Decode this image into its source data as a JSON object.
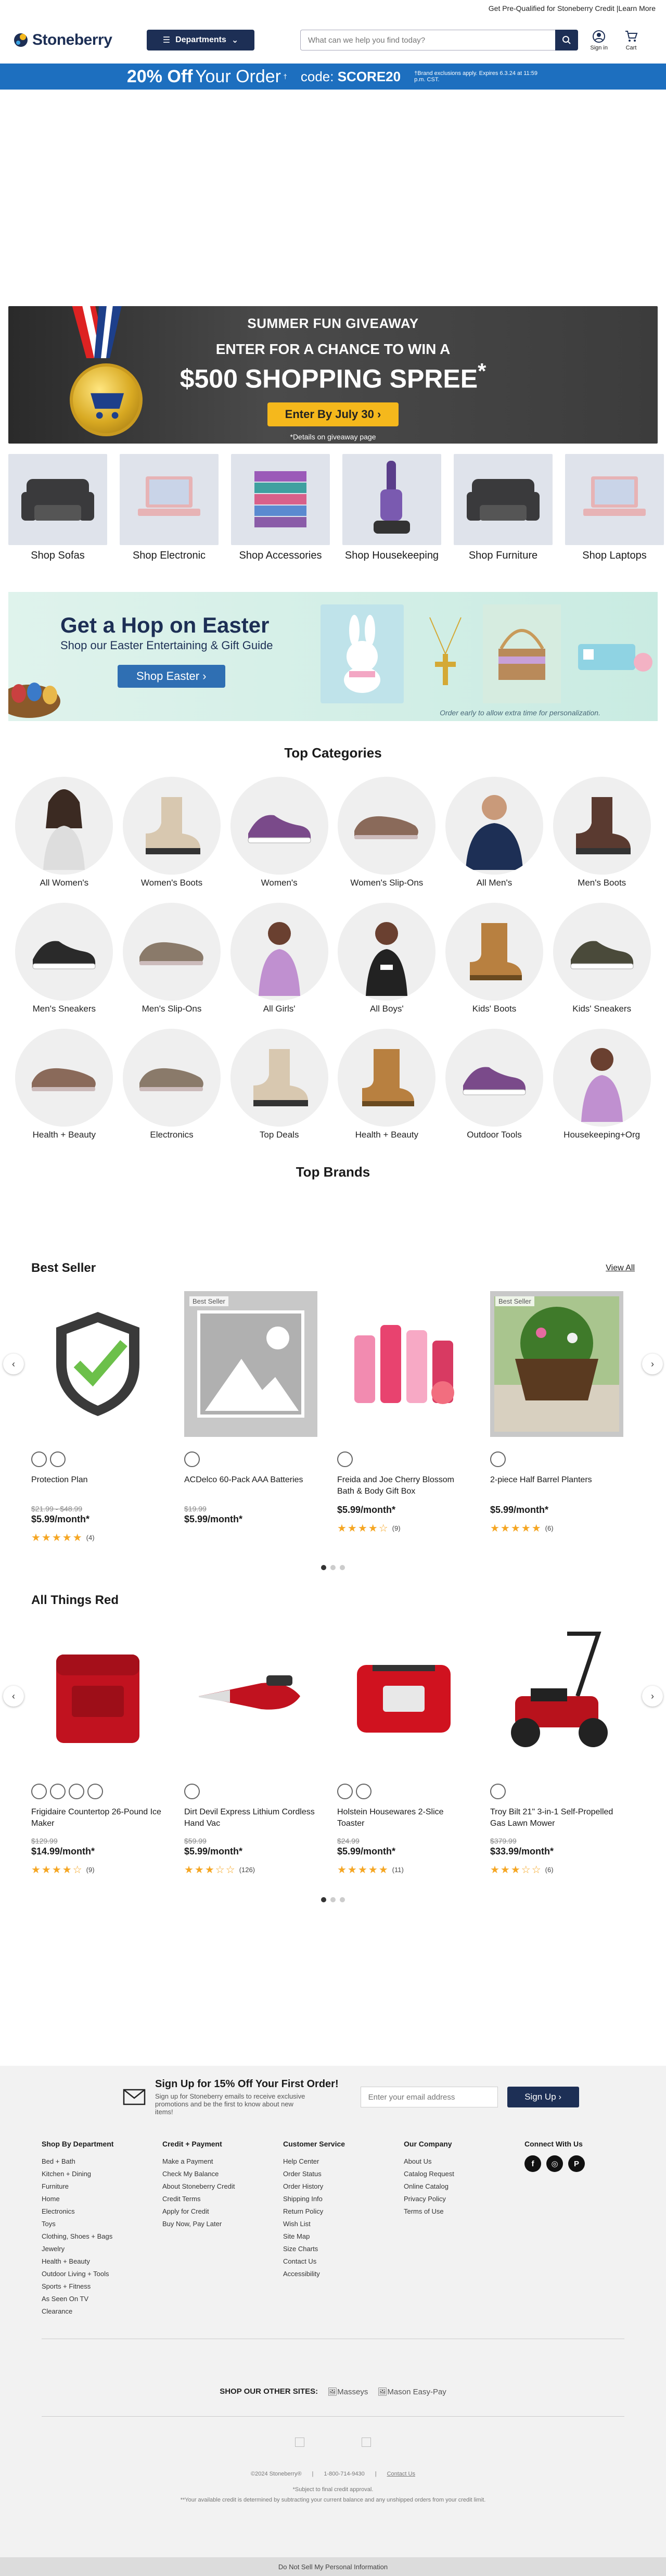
{
  "topstrip": {
    "text": "Get Pre-Qualified for Stoneberry Credit",
    "link": "Learn More"
  },
  "header": {
    "logo": "Stoneberry",
    "departments": "Departments",
    "search_placeholder": "What can we help you find today?",
    "signin": "Sign in",
    "cart": "Cart"
  },
  "promo": {
    "big": "20% Off",
    "mid": "Your Order",
    "sup": "†",
    "code_label": "code:",
    "code": "SCORE20",
    "fine": "†Brand exclusions apply. Expires 6.3.24 at 11:59 p.m. CST."
  },
  "giveaway": {
    "t1": "SUMMER FUN GIVEAWAY",
    "t2": "ENTER FOR A CHANCE TO WIN A",
    "t3": "$500 SHOPPING SPREE",
    "t3sup": "*",
    "btn": "Enter By July 30",
    "fine": "*Details on giveaway page"
  },
  "shop_tiles": [
    {
      "label": "Shop Sofas",
      "icon": "sofa",
      "color": "#3a3a3c"
    },
    {
      "label": "Shop Electronic",
      "icon": "laptop",
      "color": "#e7b3b5"
    },
    {
      "label": "Shop Accessories",
      "icon": "towels",
      "color": "#8a5ca8"
    },
    {
      "label": "Shop Housekeeping",
      "icon": "vacuum",
      "color": "#5a3e8a"
    },
    {
      "label": "Shop Furniture",
      "icon": "sofa",
      "color": "#3a3a3c"
    },
    {
      "label": "Shop Laptops",
      "icon": "laptop",
      "color": "#e7b3b5"
    }
  ],
  "easter": {
    "title": "Get a Hop on Easter",
    "subtitle": "Shop our Easter Entertaining & Gift Guide",
    "btn": "Shop Easter",
    "fine": "Order early to allow extra time for personalization."
  },
  "top_categories_title": "Top Categories",
  "categories": [
    {
      "label": "All Women's",
      "icon": "woman",
      "color": "#3b2a22"
    },
    {
      "label": "Women's Boots",
      "icon": "boot",
      "color": "#d8c8b0"
    },
    {
      "label": "Women's",
      "icon": "sneaker",
      "color": "#7a4a8a"
    },
    {
      "label": "Women's Slip-Ons",
      "icon": "slipon",
      "color": "#8a6a5a"
    },
    {
      "label": "All Men's",
      "icon": "man",
      "color": "#1d2f55"
    },
    {
      "label": "Men's Boots",
      "icon": "boot",
      "color": "#5a3a30"
    },
    {
      "label": "Men's Sneakers",
      "icon": "sneaker",
      "color": "#2a2a2a"
    },
    {
      "label": "Men's Slip-Ons",
      "icon": "slipon",
      "color": "#8a7a6a"
    },
    {
      "label": "All Girls'",
      "icon": "girl",
      "color": "#c090d0"
    },
    {
      "label": "All Boys'",
      "icon": "boy",
      "color": "#222222"
    },
    {
      "label": "Kids' Boots",
      "icon": "uggboot",
      "color": "#b88040"
    },
    {
      "label": "Kids' Sneakers",
      "icon": "sneaker",
      "color": "#4a4a3a"
    },
    {
      "label": "Health + Beauty",
      "icon": "slipon",
      "color": "#8a6a5a"
    },
    {
      "label": "Electronics",
      "icon": "slipon",
      "color": "#8a7a6a"
    },
    {
      "label": "Top Deals",
      "icon": "boot",
      "color": "#d8c8b0"
    },
    {
      "label": "Health + Beauty",
      "icon": "uggboot",
      "color": "#b88040"
    },
    {
      "label": "Outdoor Tools",
      "icon": "sneaker",
      "color": "#7a4a8a"
    },
    {
      "label": "Housekeeping+Org",
      "icon": "girl",
      "color": "#c090d0"
    }
  ],
  "top_brands_title": "Top Brands",
  "best_seller": {
    "title": "Best Seller",
    "view_all": "View All",
    "products": [
      {
        "name": "Protection Plan",
        "price": "$21.99 - $48.99",
        "month": "$5.99/month*",
        "stars": "★★★★★",
        "count": "(4)",
        "badge": "",
        "image": "shield",
        "swatches": 2
      },
      {
        "name": "ACDelco 60-Pack AAA Batteries",
        "price": "$19.99",
        "month": "$5.99/month*",
        "stars": "",
        "count": "",
        "badge": "Best Seller",
        "image": "placeholder",
        "swatches": 1
      },
      {
        "name": "Freida and Joe Cherry Blossom Bath & Body Gift Box",
        "price": "",
        "month": "$5.99/month*",
        "stars": "★★★★☆",
        "count": "(9)",
        "badge": "",
        "image": "giftbox",
        "swatches": 1
      },
      {
        "name": "2-piece Half Barrel Planters",
        "price": "",
        "month": "$5.99/month*",
        "stars": "★★★★★",
        "count": "(6)",
        "badge": "Best Seller",
        "image": "planter",
        "swatches": 1
      }
    ]
  },
  "all_red": {
    "title": "All Things Red",
    "products": [
      {
        "name": "Frigidaire Countertop 26-Pound Ice Maker",
        "price": "$129.99",
        "month": "$14.99/month*",
        "stars": "★★★★☆",
        "count": "(9)",
        "image": "icemaker",
        "swatches": 4
      },
      {
        "name": "Dirt Devil Express Lithium Cordless Hand Vac",
        "price": "$59.99",
        "month": "$5.99/month*",
        "stars": "★★★☆☆",
        "count": "(126)",
        "image": "handvac",
        "swatches": 1
      },
      {
        "name": "Holstein Housewares 2-Slice Toaster",
        "price": "$24.99",
        "month": "$5.99/month*",
        "stars": "★★★★★",
        "count": "(11)",
        "image": "toaster",
        "swatches": 2
      },
      {
        "name": "Troy Bilt 21\" 3-in-1 Self-Propelled Gas Lawn Mower",
        "price": "$379.99",
        "month": "$33.99/month*",
        "stars": "★★★☆☆",
        "count": "(6)",
        "image": "mower",
        "swatches": 1
      }
    ]
  },
  "footer": {
    "signup_title": "Sign Up for 15% Off Your First Order!",
    "signup_desc": "Sign up for Stoneberry emails to receive exclusive promotions and be the first to know about new items!",
    "email_placeholder": "Enter your email address",
    "signup_btn": "Sign Up",
    "cols": [
      {
        "title": "Shop By Department",
        "items": [
          "Bed + Bath",
          "Kitchen + Dining",
          "Furniture",
          "Home",
          "Electronics",
          "Toys",
          "Clothing, Shoes + Bags",
          "Jewelry",
          "Health + Beauty",
          "Outdoor Living + Tools",
          "Sports + Fitness",
          "As Seen On TV",
          "Clearance"
        ]
      },
      {
        "title": "Credit + Payment",
        "items": [
          "Make a Payment",
          "Check My Balance",
          "About Stoneberry Credit",
          "Credit Terms",
          "Apply for Credit",
          "Buy Now, Pay Later"
        ]
      },
      {
        "title": "Customer Service",
        "items": [
          "Help Center",
          "Order Status",
          "Order History",
          "Shipping Info",
          "Return Policy",
          "Wish List",
          "Site Map",
          "Size Charts",
          "Contact Us",
          "Accessibility"
        ]
      },
      {
        "title": "Our Company",
        "items": [
          "About Us",
          "Catalog Request",
          "Online Catalog",
          "Privacy Policy",
          "Terms of Use"
        ]
      }
    ],
    "connect": "Connect With Us",
    "other_sites": "SHOP OUR OTHER SITES:",
    "site1": "Masseys",
    "site2": "Mason Easy-Pay",
    "copyright": "©2024 Stoneberry®",
    "phone": "1-800-714-9430",
    "contact": "Contact Us",
    "fine1": "*Subject to final credit approval.",
    "fine2": "**Your available credit is determined by subtracting your current balance and any unshipped orders from your credit limit.",
    "dnsmpi": "Do Not Sell My Personal Information"
  },
  "colors": {
    "navy": "#1d2f55",
    "promo_blue": "#1d6fbf",
    "gold": "#f5b81c",
    "star": "#f5a623"
  }
}
